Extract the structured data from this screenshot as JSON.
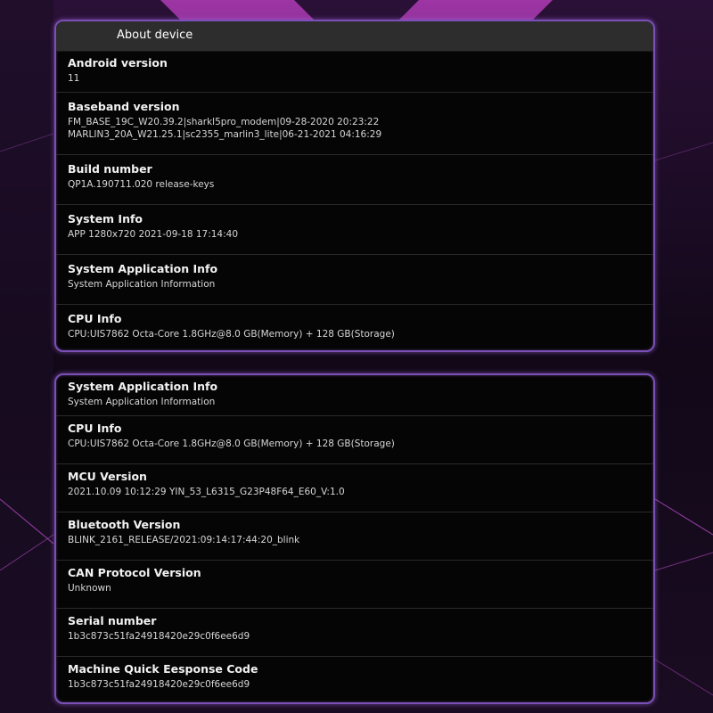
{
  "colors": {
    "panel_border": "#7a4fb8",
    "panel_bg": "#050505",
    "header_bg": "#2d2d2d",
    "background": "#150a1c",
    "accent_glow": "#c040c0"
  },
  "top_panel": {
    "header": "About device",
    "rows": [
      {
        "title": "Android version",
        "value": "11"
      },
      {
        "title": "Baseband version",
        "value": "FM_BASE_19C_W20.39.2|sharkl5pro_modem|09-28-2020 20:23:22",
        "value2": "MARLIN3_20A_W21.25.1|sc2355_marlin3_lite|06-21-2021 04:16:29"
      },
      {
        "title": "Build number",
        "value": "QP1A.190711.020 release-keys"
      },
      {
        "title": "System Info",
        "value": "APP 1280x720 2021-09-18 17:14:40"
      },
      {
        "title": "System Application Info",
        "value": "System Application Information"
      },
      {
        "title": "CPU Info",
        "value": "CPU:UIS7862 Octa-Core 1.8GHz@8.0 GB(Memory) + 128 GB(Storage)"
      }
    ]
  },
  "bottom_panel": {
    "rows": [
      {
        "title": "System Application Info",
        "value": "System Application Information"
      },
      {
        "title": "CPU Info",
        "value": "CPU:UIS7862 Octa-Core 1.8GHz@8.0 GB(Memory) + 128 GB(Storage)"
      },
      {
        "title": "MCU Version",
        "value": "2021.10.09 10:12:29 YIN_53_L6315_G23P48F64_E60_V:1.0"
      },
      {
        "title": "Bluetooth Version",
        "value": "BLINK_2161_RELEASE/2021:09:14:17:44:20_blink"
      },
      {
        "title": "CAN Protocol Version",
        "value": "Unknown"
      },
      {
        "title": "Serial number",
        "value": "1b3c873c51fa24918420e29c0f6ee6d9"
      },
      {
        "title": "Machine Quick Eesponse Code",
        "value": "1b3c873c51fa24918420e29c0f6ee6d9"
      }
    ]
  }
}
